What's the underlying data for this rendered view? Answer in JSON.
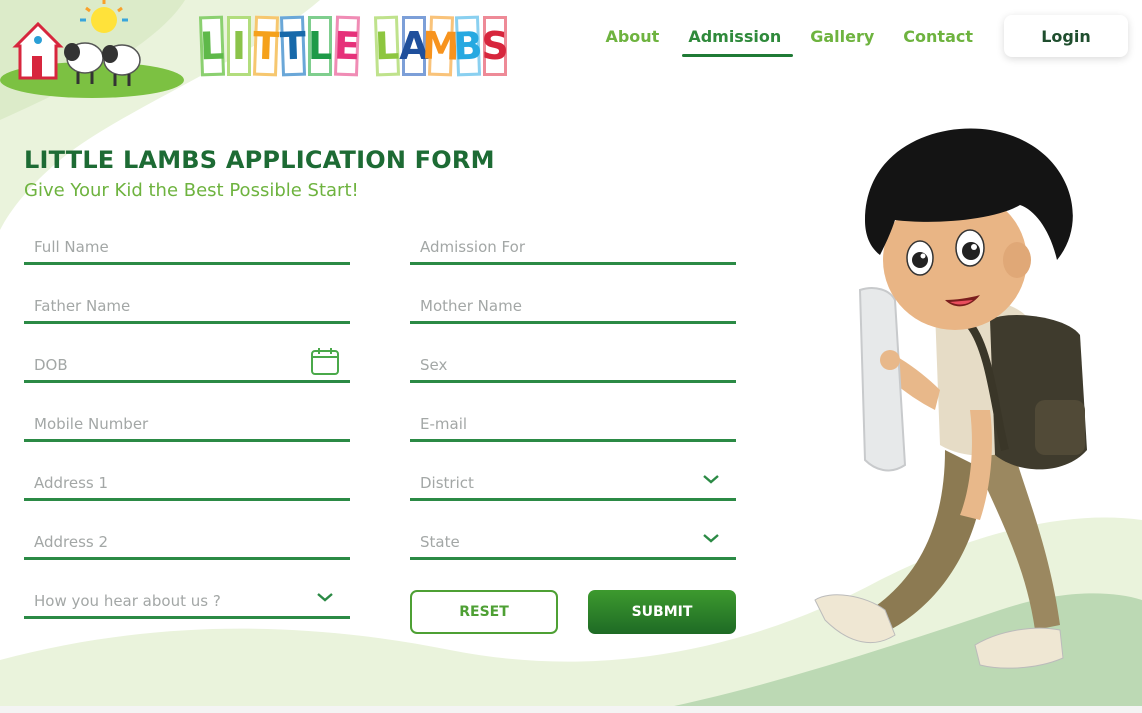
{
  "brand": {
    "name": "LITTLE LAMBS",
    "letters": [
      {
        "char": "L",
        "color": "#5fb94a",
        "border": "#8bd070"
      },
      {
        "char": "I",
        "color": "#8bc34a",
        "border": "#b2dd7d"
      },
      {
        "char": "T",
        "color": "#f5a11b",
        "border": "#f6c76f"
      },
      {
        "char": "T",
        "color": "#1769aa",
        "border": "#6aa7d8"
      },
      {
        "char": "L",
        "color": "#1e9a48",
        "border": "#7fce8e"
      },
      {
        "char": "E",
        "color": "#e6317a",
        "border": "#f08cb5"
      },
      {
        "char": "L",
        "color": "#8dc63f",
        "border": "#bfe28c"
      },
      {
        "char": "A",
        "color": "#1f4f9c",
        "border": "#7c9fd8"
      },
      {
        "char": "M",
        "color": "#f7931e",
        "border": "#f9c37a"
      },
      {
        "char": "B",
        "color": "#27a9e1",
        "border": "#8ad0f0"
      },
      {
        "char": "S",
        "color": "#d7263d",
        "border": "#ee8a97"
      }
    ]
  },
  "nav": {
    "items": [
      {
        "label": "About",
        "active": false
      },
      {
        "label": "Admission",
        "active": true
      },
      {
        "label": "Gallery",
        "active": false
      },
      {
        "label": "Contact",
        "active": false
      }
    ],
    "login_label": "Login"
  },
  "form": {
    "title": "LITTLE LAMBS APPLICATION FORM",
    "subtitle": "Give Your Kid the Best Possible Start!",
    "fields": {
      "full_name": "Full Name",
      "admission_for": "Admission For",
      "father_name": "Father Name",
      "mother_name": "Mother Name",
      "dob": "DOB",
      "sex": "Sex",
      "mobile": "Mobile Number",
      "email": "E-mail",
      "address1": "Address 1",
      "district": "District",
      "address2": "Address 2",
      "state": "State",
      "hear_about": "How you hear about us ?"
    },
    "reset_label": "RESET",
    "submit_label": "SUBMIT"
  },
  "icons": {
    "dob": "calendar-icon",
    "district": "chevron-down-icon",
    "state": "chevron-down-icon",
    "hear_about": "chevron-down-icon"
  },
  "colors": {
    "primary_green": "#1d6b34",
    "accent_green": "#6eb33f",
    "field_line": "#2b8a45",
    "bg_wave_light": "#eaf3dc",
    "bg_wave_mid": "#d5e8c4"
  }
}
